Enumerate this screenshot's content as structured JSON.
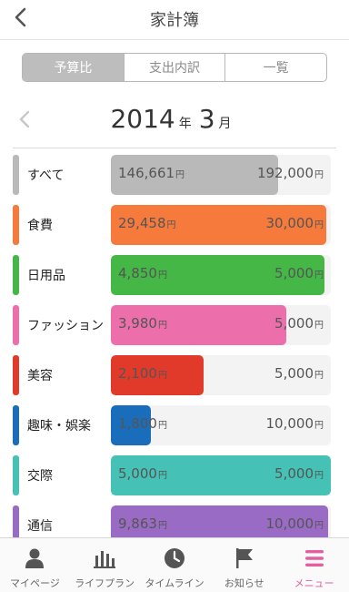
{
  "header": {
    "title": "家計簿"
  },
  "tabs": [
    {
      "label": "予算比",
      "active": true
    },
    {
      "label": "支出内訳",
      "active": false
    },
    {
      "label": "一覧",
      "active": false
    }
  ],
  "month": {
    "year": "2014",
    "year_unit": "年",
    "month": "3",
    "month_unit": "月"
  },
  "currency": "円",
  "budgets": [
    {
      "name": "すべて",
      "spent": "146,661",
      "budget": "192,000",
      "ratio": 0.76,
      "color": "#b9b9b9"
    },
    {
      "name": "食費",
      "spent": "29,458",
      "budget": "30,000",
      "ratio": 0.98,
      "color": "#f57a3c"
    },
    {
      "name": "日用品",
      "spent": "4,850",
      "budget": "5,000",
      "ratio": 0.97,
      "color": "#44b746"
    },
    {
      "name": "ファッション",
      "spent": "3,980",
      "budget": "5,000",
      "ratio": 0.796,
      "color": "#ec6fab"
    },
    {
      "name": "美容",
      "spent": "2,100",
      "budget": "5,000",
      "ratio": 0.42,
      "color": "#e23a2a"
    },
    {
      "name": "趣味・娯楽",
      "spent": "1,800",
      "budget": "10,000",
      "ratio": 0.18,
      "color": "#1a6dbb"
    },
    {
      "name": "交際",
      "spent": "5,000",
      "budget": "5,000",
      "ratio": 1.0,
      "color": "#45c1b5"
    },
    {
      "name": "通信",
      "spent": "9,863",
      "budget": "10,000",
      "ratio": 0.986,
      "color": "#9a6bc4"
    }
  ],
  "tabbar": [
    {
      "label": "マイページ",
      "icon": "person-icon",
      "active": false
    },
    {
      "label": "ライフプラン",
      "icon": "bar-chart-icon",
      "active": false
    },
    {
      "label": "タイムライン",
      "icon": "clock-icon",
      "active": false
    },
    {
      "label": "お知らせ",
      "icon": "flag-icon",
      "active": false
    },
    {
      "label": "メニュー",
      "icon": "menu-icon",
      "active": true
    }
  ],
  "colors": {
    "accent": "#e2609f",
    "tab_active_bg": "#bdbdbd"
  }
}
